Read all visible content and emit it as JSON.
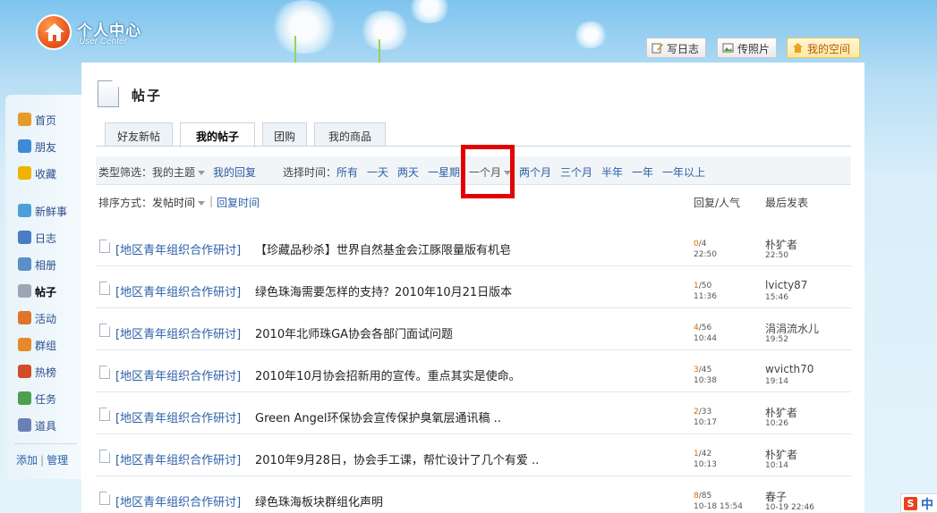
{
  "header": {
    "logo_title": "个人中心",
    "logo_subtitle": "User Center",
    "buttons": {
      "write_blog": "写日志",
      "upload_photo": "传照片",
      "my_space": "我的空间"
    }
  },
  "sidebar": {
    "items": [
      {
        "label": "首页",
        "icon": "home-icon",
        "color": "#e59b2b"
      },
      {
        "label": "朋友",
        "icon": "friends-icon",
        "color": "#3e8ad6"
      },
      {
        "label": "收藏",
        "icon": "star-icon",
        "color": "#f0b400"
      },
      {
        "label": "新鲜事",
        "icon": "speech-bubble-icon",
        "color": "#4d9fd9"
      },
      {
        "label": "日志",
        "icon": "blog-icon",
        "color": "#4a7cc4"
      },
      {
        "label": "相册",
        "icon": "album-icon",
        "color": "#5b8fc8"
      },
      {
        "label": "帖子",
        "icon": "post-icon",
        "color": "#9aa7b3"
      },
      {
        "label": "活动",
        "icon": "activity-icon",
        "color": "#e0742a"
      },
      {
        "label": "群组",
        "icon": "group-icon",
        "color": "#e58a2a"
      },
      {
        "label": "热榜",
        "icon": "ranking-icon",
        "color": "#d24c2a"
      },
      {
        "label": "任务",
        "icon": "task-icon",
        "color": "#4c9f4c"
      },
      {
        "label": "道具",
        "icon": "tool-icon",
        "color": "#6a7fb8"
      }
    ],
    "active_index": 6,
    "footer": {
      "add": "添加",
      "sep": "|",
      "manage": "管理"
    }
  },
  "main": {
    "title": "帖子",
    "tabs": [
      "好友新帖",
      "我的帖子",
      "团购",
      "我的商品"
    ],
    "active_tab": 1,
    "filter": {
      "type_label": "类型筛选：",
      "type_selected": "我的主题",
      "my_replies": "我的回复",
      "time_label": "选择时间：",
      "time_options": [
        "所有",
        "一天",
        "两天",
        "一星期",
        "一个月",
        "两个月",
        "三个月",
        "半年",
        "一年",
        "一年以上"
      ],
      "time_selected_index": 4
    },
    "sort": {
      "label": "排序方式：",
      "selected": "发帖时间",
      "sep": "|",
      "alt": "回复时间"
    },
    "columns": {
      "reply_views": "回复/人气",
      "last_post": "最后发表"
    },
    "posts": [
      {
        "category": "[地区青年组织合作研讨]",
        "title": "【珍藏品秒杀】世界自然基金会江豚限量版有机皂",
        "replies": "0",
        "views": "/4",
        "time": "22:50",
        "last_user": "朴犷者",
        "last_time": "22:50"
      },
      {
        "category": "[地区青年组织合作研讨]",
        "title": "绿色珠海需要怎样的支持？2010年10月21日版本",
        "replies": "1",
        "views": "/50",
        "time": "11:36",
        "last_user": "lvicty87",
        "last_time": "15:46"
      },
      {
        "category": "[地区青年组织合作研讨]",
        "title": "2010年北师珠GA协会各部门面试问题",
        "replies": "4",
        "views": "/56",
        "time": "10:44",
        "last_user": "涓涓流水儿",
        "last_time": "19:52"
      },
      {
        "category": "[地区青年组织合作研讨]",
        "title": "2010年10月协会招新用的宣传。重点其实是使命。",
        "replies": "3",
        "views": "/45",
        "time": "10:38",
        "last_user": "wvicth70",
        "last_time": "19:14"
      },
      {
        "category": "[地区青年组织合作研讨]",
        "title": "Green Angel环保协会宣传保护臭氧层通讯稿 ..",
        "replies": "2",
        "views": "/33",
        "time": "10:17",
        "last_user": "朴犷者",
        "last_time": "10:26"
      },
      {
        "category": "[地区青年组织合作研讨]",
        "title": "2010年9月28日，协会手工课，帮忙设计了几个有爱 ..",
        "replies": "1",
        "views": "/42",
        "time": "10:13",
        "last_user": "朴犷者",
        "last_time": "10:14"
      },
      {
        "category": "[地区青年组织合作研讨]",
        "title": "绿色珠海板块群组化声明",
        "replies": "8",
        "views": "/85",
        "time": "10-18 15:54",
        "last_user": "春子",
        "last_time": "10-19 22:46"
      }
    ]
  },
  "ime": {
    "brand": "S",
    "label": "中"
  },
  "colors": {
    "accent_red": "#e30000",
    "link": "#2b5fa8",
    "reply_count": "#e06a00"
  }
}
